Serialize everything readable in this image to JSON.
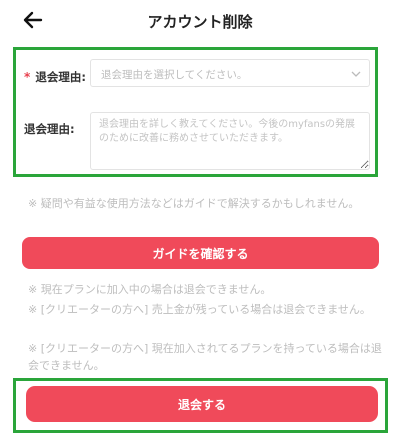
{
  "header": {
    "title": "アカウント削除",
    "back_icon": "arrow-left-icon"
  },
  "form": {
    "required_mark": "*",
    "select_label": "退会理由:",
    "select_placeholder": "退会理由を選択してください。",
    "select_icon": "chevron-down-icon",
    "detail_label": "退会理由:",
    "detail_placeholder": "退会理由を詳しく教えてください。今後のmyfansの発展のために改善に務めさせていただきます。"
  },
  "guide": {
    "note": "※ 疑問や有益な使用方法などはガイドで解決するかもしれません。",
    "button_label": "ガイドを確認する"
  },
  "notices": [
    "※ 現在プランに加入中の場合は退会できません。",
    "※ [クリエーターの方へ] 売上金が残っている場合は退会できません。",
    "※ [クリエーターの方へ] 現在加入されてるプランを持っている場合は退会できません。"
  ],
  "submit": {
    "button_label": "退会する"
  },
  "colors": {
    "accent": "#f04a5a",
    "highlight_border": "#2aa53a"
  }
}
